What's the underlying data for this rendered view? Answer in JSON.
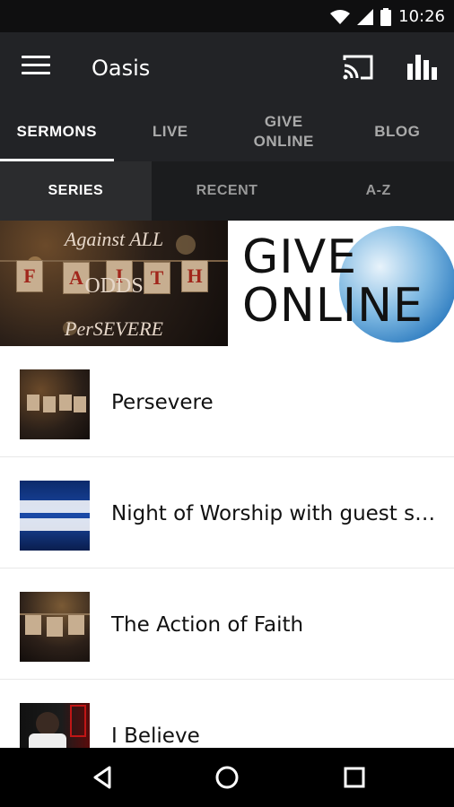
{
  "status": {
    "time": "10:26"
  },
  "app": {
    "title": "Oasis"
  },
  "tabs": [
    {
      "label": "SERMONS",
      "active": true
    },
    {
      "label": "LIVE",
      "active": false
    },
    {
      "label": "GIVE\nONLINE",
      "active": false
    },
    {
      "label": "BLOG",
      "active": false
    }
  ],
  "subtabs": [
    {
      "label": "SERIES",
      "active": true
    },
    {
      "label": "RECENT",
      "active": false
    },
    {
      "label": "A-Z",
      "active": false
    }
  ],
  "banners": {
    "faith": {
      "line1": "Against ALL",
      "cards": [
        "F",
        "A",
        "I",
        "T",
        "H"
      ],
      "line2": "ODDS",
      "line3": "PerSEVERE"
    },
    "give": {
      "line1": "GIVE",
      "line2": "ONLINE"
    }
  },
  "series": [
    {
      "title": "Persevere"
    },
    {
      "title": "Night of Worship with guest s…"
    },
    {
      "title": "The Action of Faith"
    },
    {
      "title": "I Believe"
    }
  ]
}
